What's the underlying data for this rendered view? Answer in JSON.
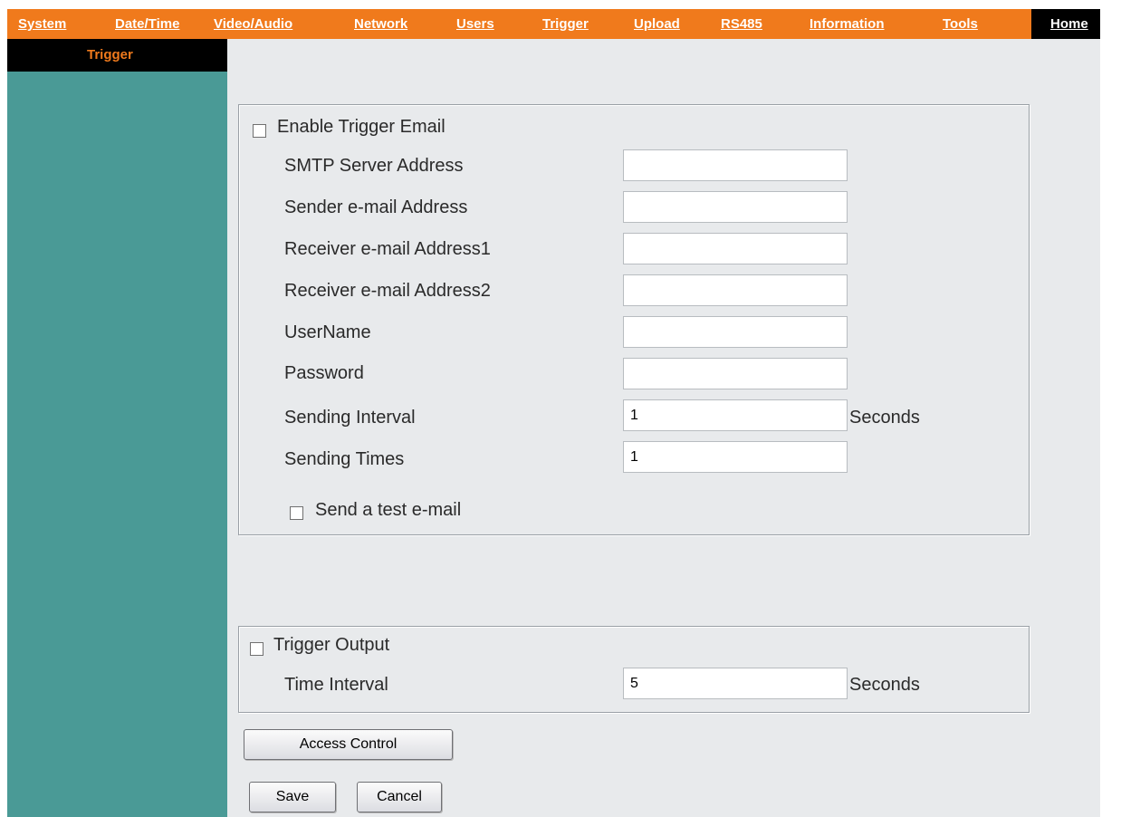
{
  "nav": {
    "items": [
      {
        "label": "System"
      },
      {
        "label": "Date/Time"
      },
      {
        "label": "Video/Audio"
      },
      {
        "label": "Network"
      },
      {
        "label": "Users"
      },
      {
        "label": "Trigger"
      },
      {
        "label": "Upload"
      },
      {
        "label": "RS485"
      },
      {
        "label": "Information"
      },
      {
        "label": "Tools"
      }
    ],
    "home_label": "Home"
  },
  "sidebar": {
    "header": "Trigger"
  },
  "email": {
    "enable_label": "Enable Trigger Email",
    "fields": [
      {
        "label": "SMTP Server Address",
        "value": ""
      },
      {
        "label": "Sender e-mail Address",
        "value": ""
      },
      {
        "label": "Receiver e-mail Address1",
        "value": ""
      },
      {
        "label": "Receiver e-mail Address2",
        "value": ""
      },
      {
        "label": "UserName",
        "value": ""
      },
      {
        "label": "Password",
        "value": ""
      },
      {
        "label": "Sending Interval",
        "value": "1",
        "unit": "Seconds"
      },
      {
        "label": "Sending Times",
        "value": "1"
      }
    ],
    "test_label": "Send a test e-mail"
  },
  "output": {
    "enable_label": "Trigger Output",
    "interval_label": "Time Interval",
    "interval_value": "5",
    "interval_unit": "Seconds"
  },
  "buttons": {
    "access_control": "Access Control",
    "save": "Save",
    "cancel": "Cancel"
  },
  "colors": {
    "nav_bg": "#f07a1c",
    "sidebar_bg": "#4a9a96",
    "content_bg": "#e8eaec"
  }
}
